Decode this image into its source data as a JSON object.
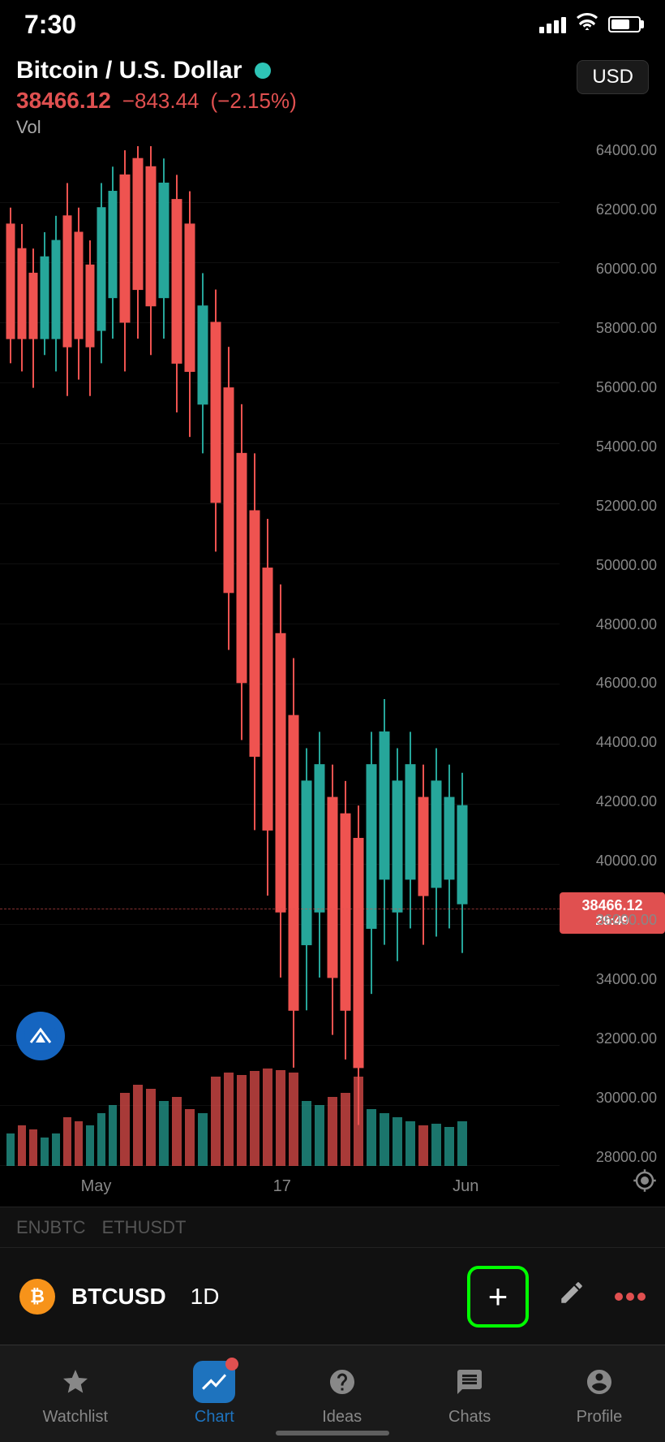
{
  "statusBar": {
    "time": "7:30",
    "signalBars": [
      6,
      10,
      14,
      18,
      22
    ],
    "battery": 70
  },
  "header": {
    "pairName": "Bitcoin / U.S. Dollar",
    "currencyBadge": "USD",
    "price": "38466.12",
    "change": "−843.44",
    "changePct": "(−2.15%)",
    "volLabel": "Vol"
  },
  "chart": {
    "priceLabels": [
      "64000.00",
      "62000.00",
      "60000.00",
      "58000.00",
      "56000.00",
      "54000.00",
      "52000.00",
      "50000.00",
      "48000.00",
      "46000.00",
      "44000.00",
      "42000.00",
      "40000.00",
      "38466.12",
      "36000.00",
      "34000.00",
      "32000.00",
      "30000.00",
      "28000.00"
    ],
    "currentPrice": "38466.12",
    "currentTime": "29:49",
    "timeLabels": [
      "May",
      "17",
      "Jun"
    ],
    "settingsIcon": "⚙"
  },
  "tickerStrip": {
    "items": [
      "ENJBTC",
      "ETHUSDT"
    ]
  },
  "toolbar": {
    "symbol": "BTCUSD",
    "timeframe": "1D",
    "addLabel": "+",
    "pencilIcon": "✏",
    "dotsIcon": "···"
  },
  "bottomNav": {
    "items": [
      {
        "id": "watchlist",
        "label": "Watchlist",
        "icon": "☆",
        "active": false
      },
      {
        "id": "chart",
        "label": "Chart",
        "icon": "📈",
        "active": true
      },
      {
        "id": "ideas",
        "label": "Ideas",
        "icon": "💡",
        "active": false
      },
      {
        "id": "chats",
        "label": "Chats",
        "icon": "💬",
        "active": false
      },
      {
        "id": "profile",
        "label": "Profile",
        "icon": "😊",
        "active": false
      }
    ]
  },
  "colors": {
    "background": "#000000",
    "bullCandle": "#26a69a",
    "bearCandle": "#ef5350",
    "gridLine": "rgba(255,255,255,0.06)",
    "activeNav": "#1e73be",
    "addButtonBorder": "#00ff00",
    "priceLineColor": "#ef5350"
  }
}
